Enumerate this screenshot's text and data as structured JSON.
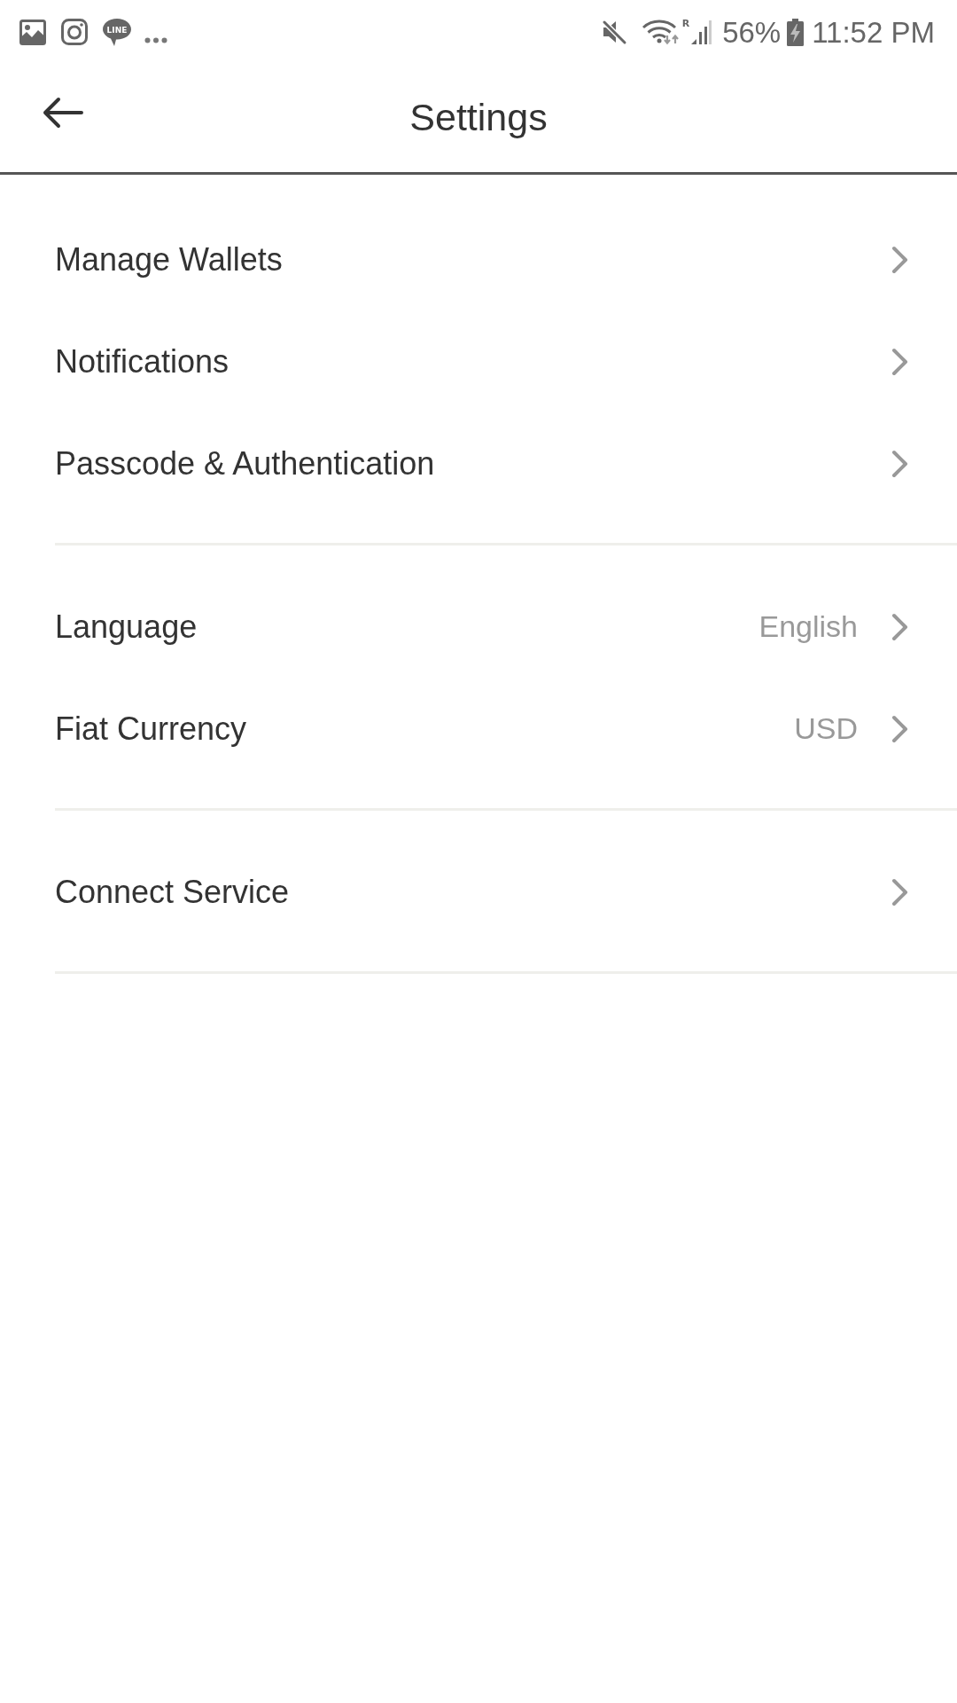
{
  "status_bar": {
    "chat_icon_text": "LINE",
    "roaming": "R",
    "battery": "56%",
    "time": "11:52 PM"
  },
  "header": {
    "title": "Settings"
  },
  "sections": [
    {
      "items": [
        {
          "label": "Manage Wallets"
        },
        {
          "label": "Notifications"
        },
        {
          "label": "Passcode & Authentication"
        }
      ]
    },
    {
      "items": [
        {
          "label": "Language",
          "value": "English"
        },
        {
          "label": "Fiat Currency",
          "value": "USD"
        }
      ]
    },
    {
      "items": [
        {
          "label": "Connect Service"
        }
      ]
    }
  ]
}
